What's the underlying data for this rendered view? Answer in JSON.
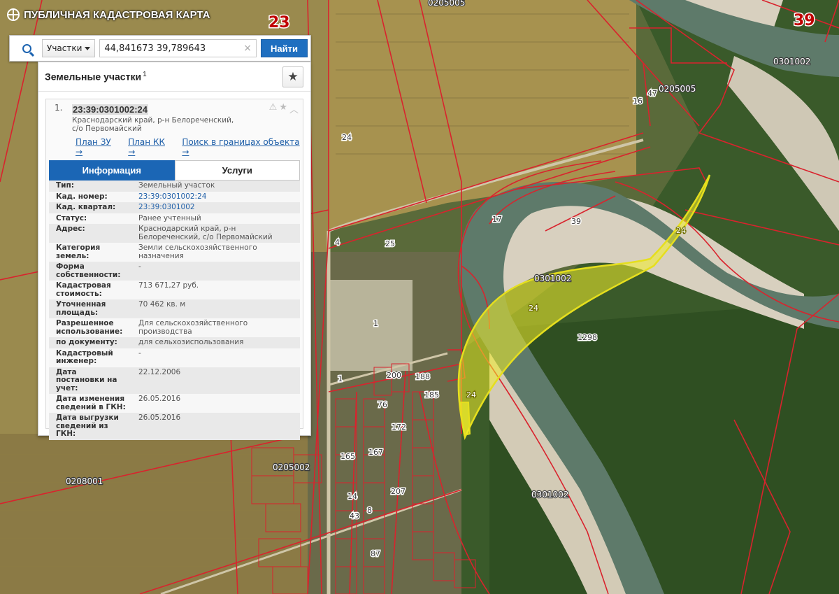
{
  "app": {
    "title": "ПУБЛИЧНАЯ КАДАСТРОВАЯ КАРТА",
    "logo_icon": "crosshair-globe-icon"
  },
  "search": {
    "type_label": "Участки",
    "query": "44,841673 39,789643",
    "button_label": "Найти",
    "clear_glyph": "×"
  },
  "panel": {
    "title": "Земельные участки",
    "count": "1",
    "result": {
      "index": "1.",
      "number": "23:39:0301002:24",
      "address": "Краснодарский край, р-н Белореченский, с/о Первомайский",
      "links": {
        "plan_zu": "План ЗУ →",
        "plan_kk": "План КК →",
        "search_bounds": "Поиск в границах объекта →"
      }
    },
    "tabs": {
      "info": "Информация",
      "services": "Услуги"
    },
    "info": [
      {
        "k": "Тип:",
        "v": "Земельный участок"
      },
      {
        "k": "Кад. номер:",
        "v": "23:39:0301002:24"
      },
      {
        "k": "Кад. квартал:",
        "v": "23:39:0301002"
      },
      {
        "k": "Статус:",
        "v": "Ранее учтенный"
      },
      {
        "k": "Адрес:",
        "v": "Краснодарский край, р-н Белореченский, с/о Первомайский"
      },
      {
        "k": "Категория земель:",
        "v": "Земли сельскохозяйственного назначения"
      },
      {
        "k": "Форма собственности:",
        "v": "-"
      },
      {
        "k": "Кадастровая стоимость:",
        "v": "713 671,27 руб."
      },
      {
        "k": "Уточненная площадь:",
        "v": "70 462 кв. м"
      },
      {
        "k": "Разрешенное использование:",
        "v": "Для сельскохозяйственного производства"
      },
      {
        "k": "по документу:",
        "v": "для сельхозиспользования"
      },
      {
        "k": "Кадастровый инженер:",
        "v": "-"
      },
      {
        "k": "Дата постановки на учет:",
        "v": "22.12.2006"
      },
      {
        "k": "Дата изменения сведений в ГКН:",
        "v": "26.05.2016"
      },
      {
        "k": "Дата выгрузки сведений из ГКН:",
        "v": "26.05.2016"
      }
    ]
  },
  "map": {
    "labels": {
      "district": "23",
      "q39": "39",
      "q0205005_top": "0205005",
      "q0205005": "0205005",
      "q0301002_top": "0301002",
      "q0301002_center": "0301002",
      "q0301002_bottom": "0301002",
      "q0205002": "0205002",
      "q0208001": "0208001",
      "p24_a": "24",
      "p24_b": "24",
      "p24_c": "24",
      "p24_d": "24",
      "p25": "25",
      "p4": "4",
      "p17": "17",
      "p39": "39",
      "p16": "16",
      "p47": "47",
      "p1": "1",
      "p1b": "1",
      "p1298": "1298",
      "p200": "200",
      "p188": "188",
      "p185": "185",
      "p76": "76",
      "p172": "172",
      "p167": "167",
      "p165": "165",
      "p14": "14",
      "p43": "43",
      "p8": "8",
      "p87": "87",
      "p207": "207"
    },
    "colors": {
      "field": "#b39a55",
      "forest": "#2f4f22",
      "river": "#5e7a6a",
      "sand": "#d8d0bf",
      "boundary": "#d9232d",
      "highlight": "#f2ee2a"
    }
  }
}
